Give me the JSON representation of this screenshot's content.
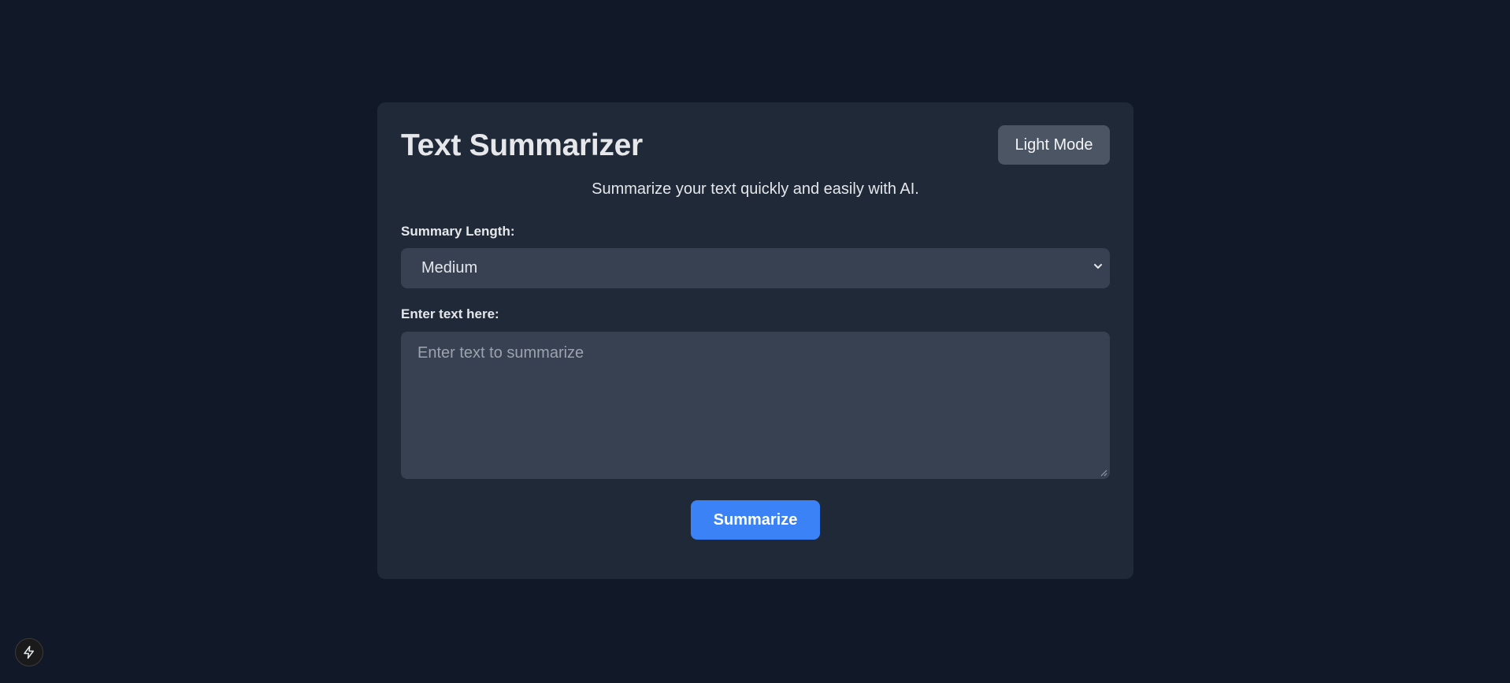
{
  "header": {
    "title": "Text Summarizer",
    "mode_toggle_label": "Light Mode"
  },
  "subtitle": "Summarize your text quickly and easily with AI.",
  "summary_length": {
    "label": "Summary Length:",
    "selected": "Medium"
  },
  "text_input": {
    "label": "Enter text here:",
    "placeholder": "Enter text to summarize",
    "value": ""
  },
  "actions": {
    "summarize_label": "Summarize"
  },
  "icons": {
    "select_chevron": "chevron-down-icon",
    "fab": "lightning-icon"
  },
  "colors": {
    "page_bg": "#111827",
    "card_bg": "#1f2937",
    "field_bg": "#374151",
    "toggle_bg": "#4b5563",
    "primary": "#3b82f6"
  }
}
